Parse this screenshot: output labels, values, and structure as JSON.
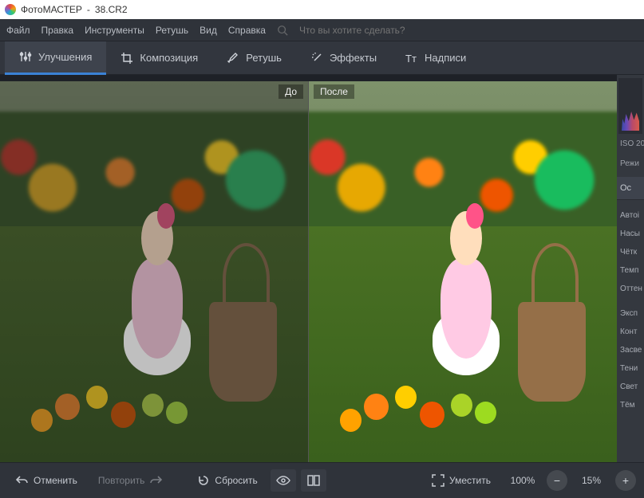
{
  "titlebar": {
    "app": "ФотоМАСТЕР",
    "file": "38.CR2"
  },
  "menu": {
    "file": "Файл",
    "edit": "Правка",
    "tools": "Инструменты",
    "retouch": "Ретушь",
    "view": "Вид",
    "help": "Справка",
    "search_placeholder": "Что вы хотите сделать?"
  },
  "tabs": {
    "enhance": "Улучшения",
    "composition": "Композиция",
    "retouch": "Ретушь",
    "effects": "Эффекты",
    "text": "Надписи"
  },
  "compare": {
    "before": "До",
    "after": "После"
  },
  "right_panel": {
    "iso_label": "ISO 20",
    "mode_label": "Режи",
    "tab_main": "Ос",
    "items": [
      "Автоі",
      "Насы",
      "Чётк",
      "Темп",
      "Оттен",
      "Эксп",
      "Конт",
      "Засве",
      "Тени",
      "Свет",
      "Тём"
    ]
  },
  "bottombar": {
    "undo": "Отменить",
    "redo": "Повторить",
    "reset": "Сбросить",
    "fit": "Уместить",
    "zoom1": "100%",
    "zoom2": "15%"
  }
}
